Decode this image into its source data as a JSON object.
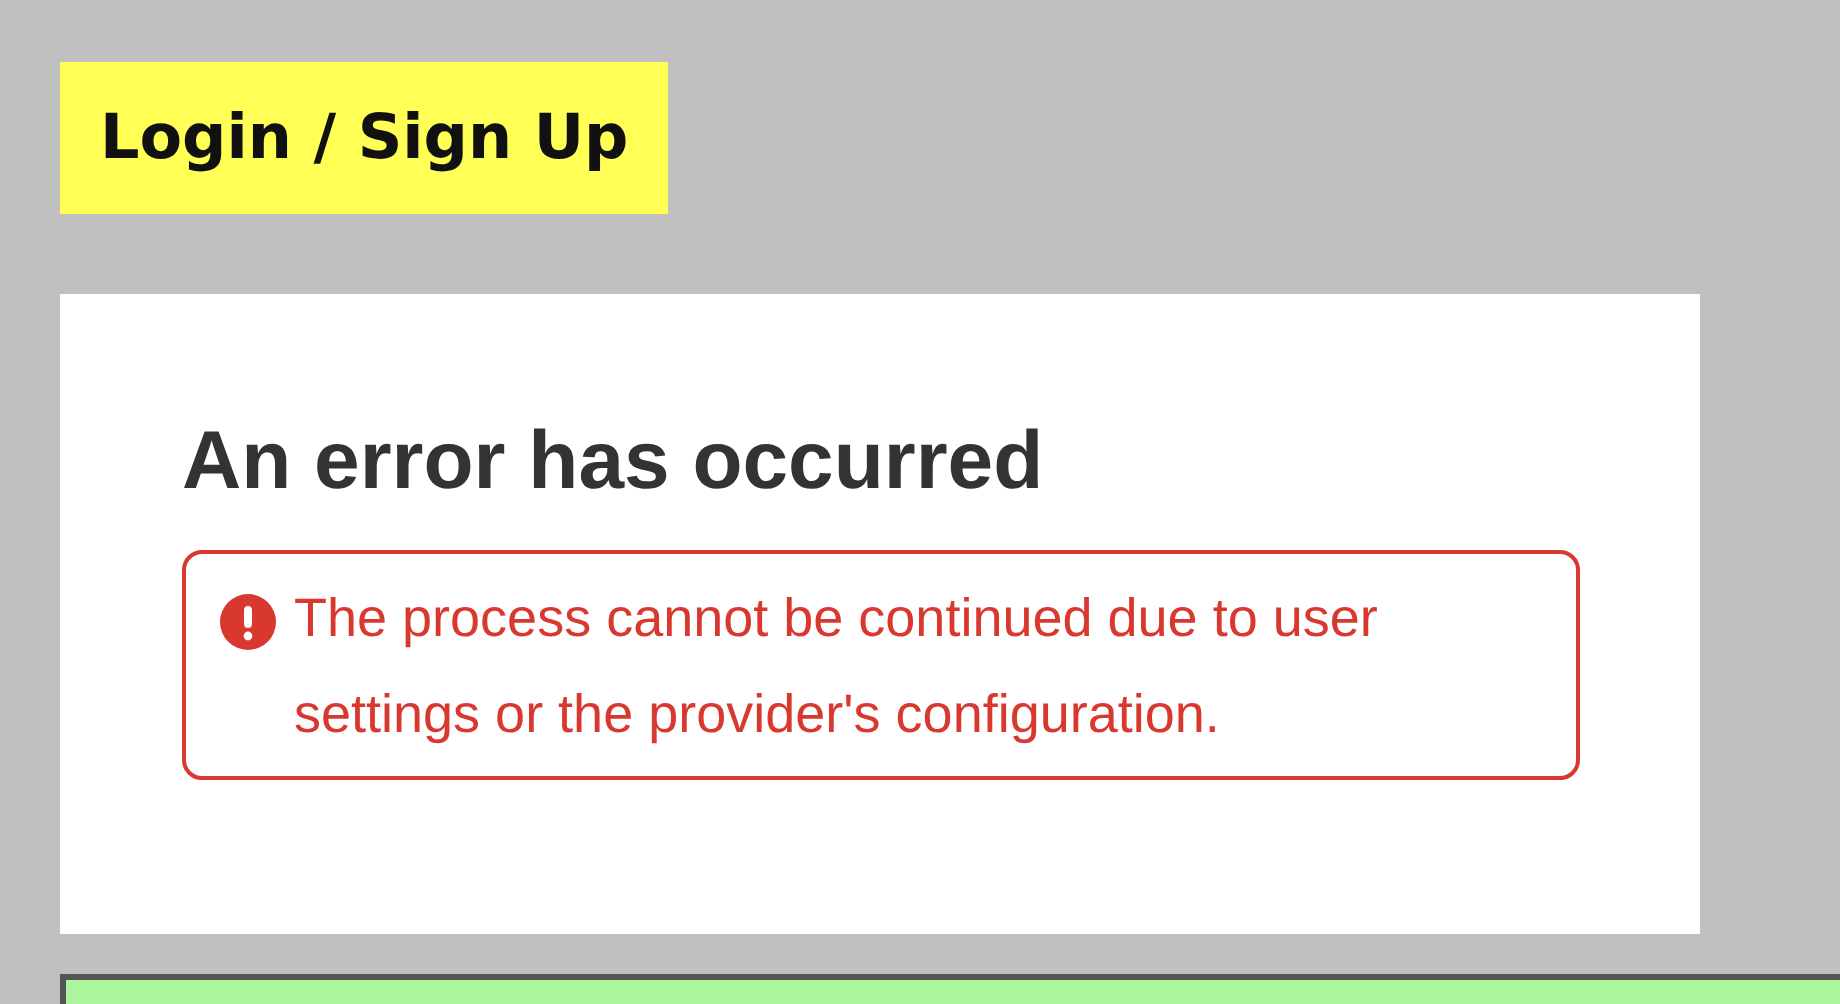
{
  "header": {
    "title": "Login / Sign Up"
  },
  "error_card": {
    "heading": "An error has occurred",
    "message": "The process cannot be continued due to user settings or the provider's configuration."
  }
}
